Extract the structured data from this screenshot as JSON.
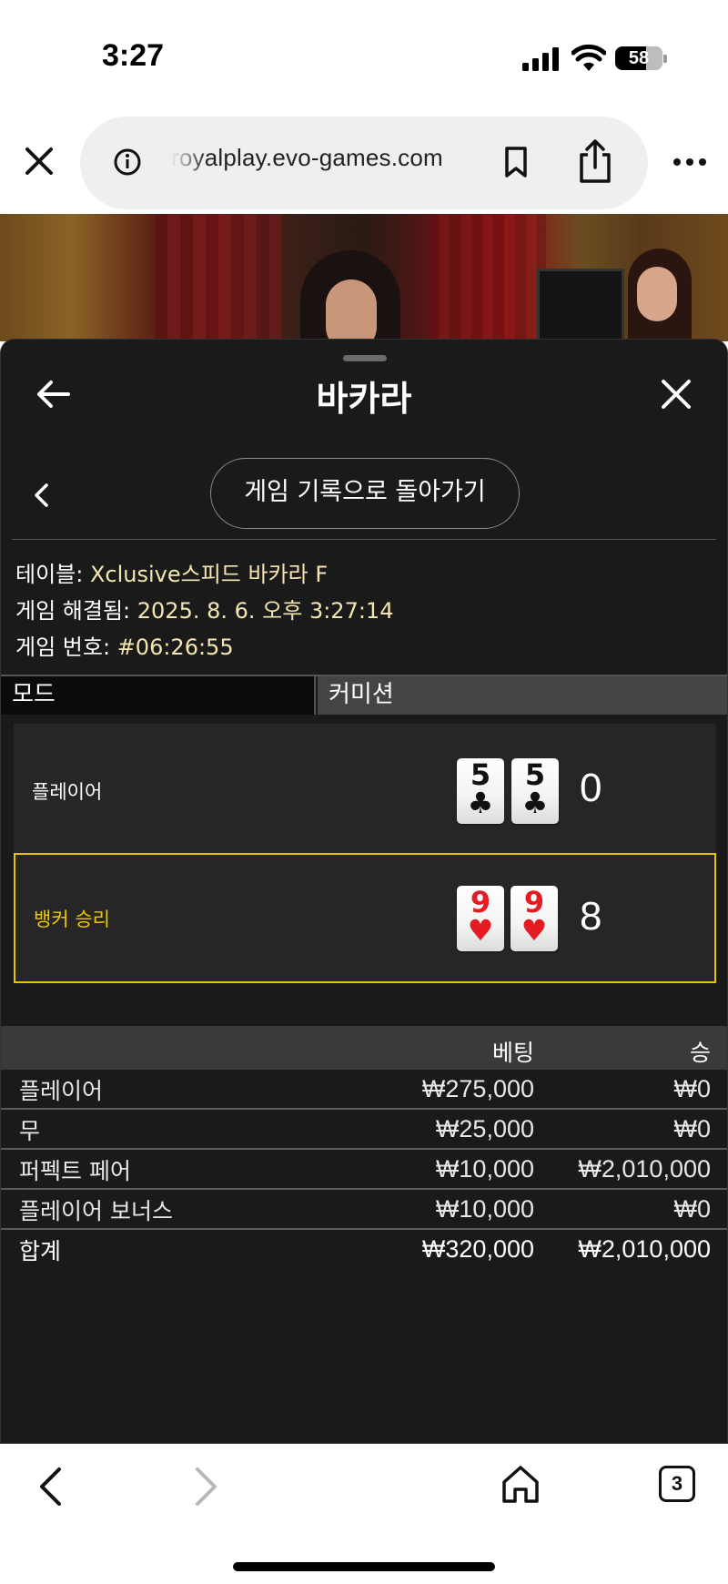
{
  "status_bar": {
    "time": "3:27",
    "battery": "58"
  },
  "browser": {
    "url": "royalplay.evo-games.com",
    "tab_count": "3"
  },
  "panel": {
    "title": "바카라",
    "history_button": "게임 기록으로 돌아가기",
    "meta": {
      "table_label": "테이블:",
      "table_value": "Xclusive스피드 바카라 F",
      "resolved_label": "게임 해결됨:",
      "resolved_value": "2025. 8. 6. 오후 3:27:14",
      "game_no_label": "게임 번호:",
      "game_no_value": "#06:26:55"
    },
    "mode": {
      "label": "모드",
      "value": "커미션"
    },
    "hands": {
      "player": {
        "label": "플레이어",
        "cards": [
          {
            "rank": "5",
            "suit": "♣",
            "color": "black"
          },
          {
            "rank": "5",
            "suit": "♣",
            "color": "black"
          }
        ],
        "score": "0"
      },
      "banker": {
        "label": "뱅커 승리",
        "cards": [
          {
            "rank": "9",
            "suit": "♥",
            "color": "red"
          },
          {
            "rank": "9",
            "suit": "♥",
            "color": "red"
          }
        ],
        "score": "8"
      }
    },
    "bets": {
      "header_bet": "베팅",
      "header_win": "승",
      "rows": [
        {
          "name": "플레이어",
          "amount": "₩275,000",
          "win": "₩0"
        },
        {
          "name": "무",
          "amount": "₩25,000",
          "win": "₩0"
        },
        {
          "name": "퍼펙트 페어",
          "amount": "₩10,000",
          "win": "₩2,010,000"
        },
        {
          "name": "플레이어 보너스",
          "amount": "₩10,000",
          "win": "₩0"
        }
      ],
      "total": {
        "name": "합계",
        "amount": "₩320,000",
        "win": "₩2,010,000"
      }
    }
  }
}
